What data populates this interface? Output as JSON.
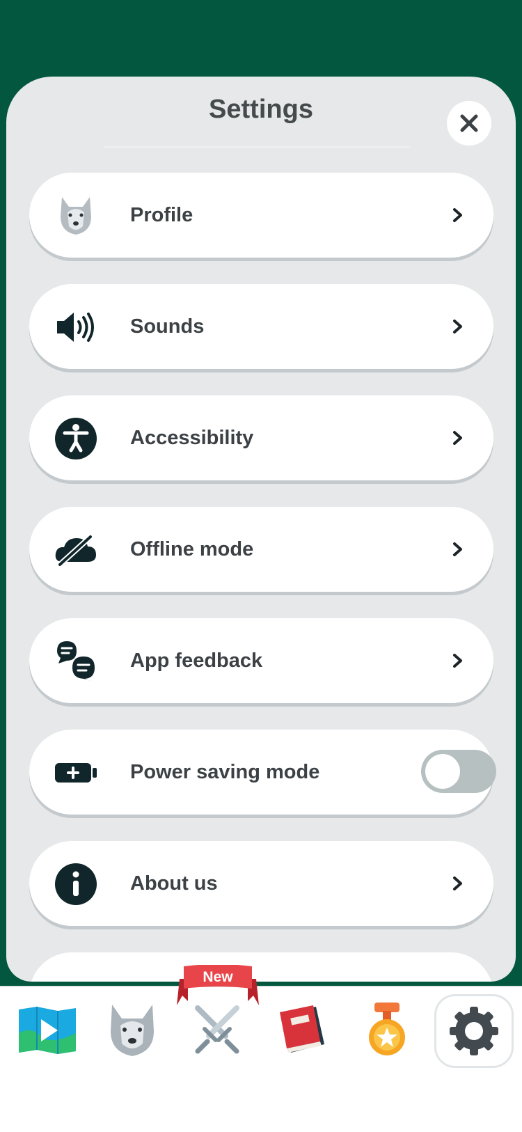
{
  "panel": {
    "title": "Settings"
  },
  "rows": [
    {
      "label": "Profile",
      "icon": "wolf-avatar-icon"
    },
    {
      "label": "Sounds",
      "icon": "speaker-icon"
    },
    {
      "label": "Accessibility",
      "icon": "accessibility-icon"
    },
    {
      "label": "Offline mode",
      "icon": "cloud-off-icon"
    },
    {
      "label": "App feedback",
      "icon": "chat-bubbles-icon"
    },
    {
      "label": "Power saving mode",
      "icon": "battery-icon",
      "toggle": false
    },
    {
      "label": "About us",
      "icon": "info-icon"
    }
  ],
  "nav": {
    "badge_label": "New",
    "items": [
      "map-icon",
      "wolf-icon",
      "swords-icon",
      "book-icon",
      "medal-icon",
      "gear-icon"
    ],
    "active": "gear-icon"
  },
  "colors": {
    "background_green": "#03573f",
    "panel": "#e6e8e9",
    "toggle_off": "#b6c0c0",
    "ribbon_red": "#e8454a"
  }
}
